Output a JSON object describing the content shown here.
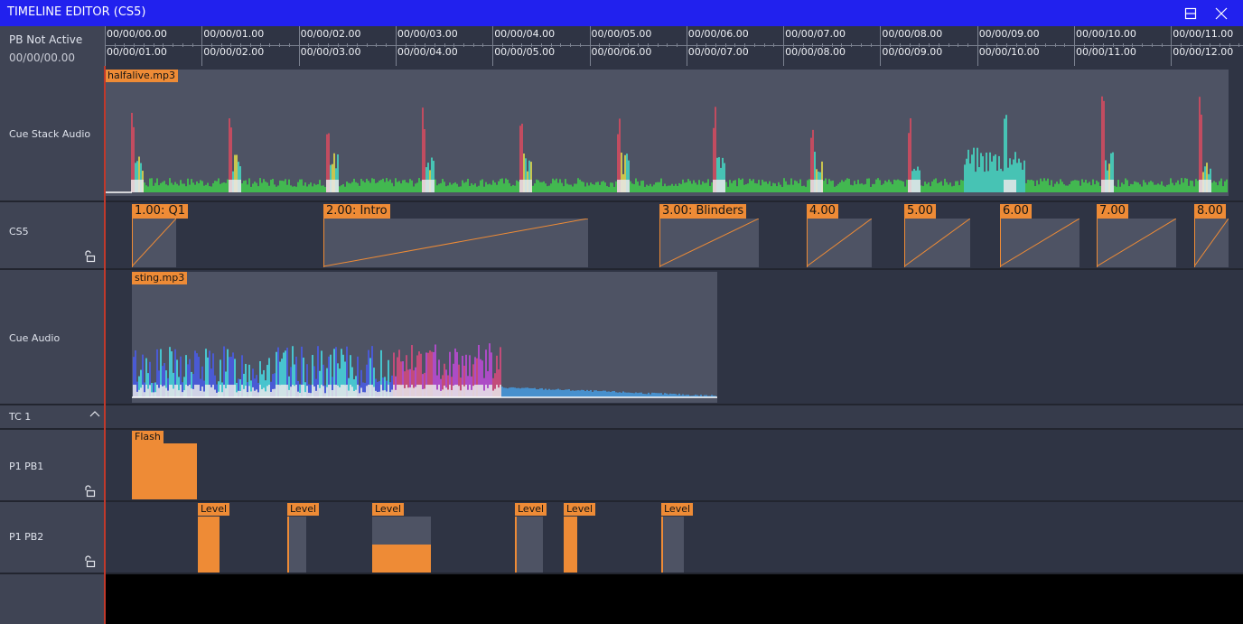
{
  "window": {
    "title": "TIMELINE EDITOR (CS5)"
  },
  "ruler": {
    "status": "PB Not Active",
    "current_time": "00/00/00.00",
    "top_ticks": [
      "00/00/00.00",
      "00/00/01.00",
      "00/00/02.00",
      "00/00/03.00",
      "00/00/04.00",
      "00/00/05.00",
      "00/00/06.00",
      "00/00/07.00",
      "00/00/08.00",
      "00/00/09.00",
      "00/00/10.00",
      "00/00/11.00"
    ],
    "bottom_ticks": [
      "00/00/01.00",
      "00/00/02.00",
      "00/00/03.00",
      "00/00/04.00",
      "00/00/05.00",
      "00/00/06.00",
      "00/00/07.00",
      "00/00/08.00",
      "00/00/09.00",
      "00/00/10.00",
      "00/00/11.00",
      "00/00/12.00"
    ]
  },
  "tracks": {
    "cue_stack_audio": {
      "label": "Cue Stack Audio",
      "file": "halfalive.mp3"
    },
    "cs5": {
      "label": "CS5",
      "cues": [
        "1.00: Q1",
        "2.00: Intro",
        "3.00: Blinders",
        "4.00",
        "5.00",
        "6.00",
        "7.00",
        "8.00"
      ]
    },
    "cue_audio": {
      "label": "Cue Audio",
      "file": "sting.mp3"
    },
    "tc1": {
      "label": "TC 1"
    },
    "p1_pb1": {
      "label": "P1 PB1",
      "events": [
        "Flash"
      ]
    },
    "p1_pb2": {
      "label": "P1 PB2",
      "events": [
        "Level",
        "Level",
        "Level",
        "Level",
        "Level",
        "Level"
      ]
    }
  },
  "colors": {
    "titlebar": "#2121ee",
    "accent": "#ee8b36",
    "panel": "#3f4454",
    "track_bg": "#2f3444",
    "clip_bg": "#4e5364",
    "playhead": "#c0392b"
  },
  "icons": {
    "restore": "restore-icon",
    "close": "close-icon",
    "lock": "unlock-icon",
    "collapse": "chevron-up-icon"
  }
}
